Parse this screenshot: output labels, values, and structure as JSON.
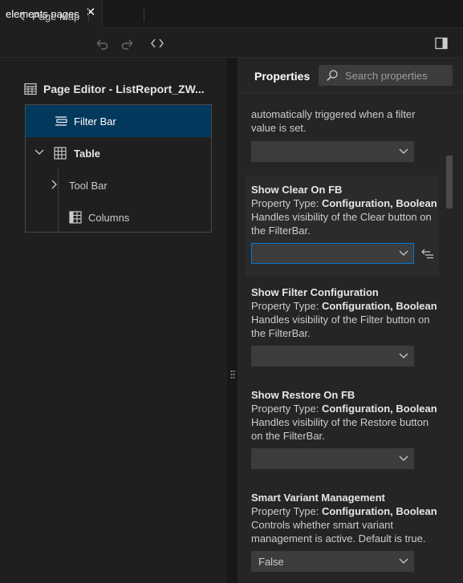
{
  "tab": {
    "title": "elements pages",
    "close_icon": "close-icon"
  },
  "toolbar": {
    "page_map_label": "Page Map",
    "icons": [
      "chevron-left-icon",
      "undo-icon",
      "redo-icon",
      "code-icon",
      "split-editor-icon"
    ]
  },
  "editor": {
    "title": "Page Editor - ListReport_ZW...",
    "tree": [
      {
        "label": "Filter Bar",
        "icon": "filter-bar-icon",
        "selected": true
      },
      {
        "label": "Table",
        "icon": "table-icon",
        "expanded": true
      },
      {
        "label": "Tool Bar",
        "icon": "chevron-right-icon"
      },
      {
        "label": "Columns",
        "icon": "columns-icon"
      }
    ]
  },
  "properties": {
    "title": "Properties",
    "search_placeholder": "Search properties",
    "partial_text_1": "automatically triggered when a filter",
    "partial_text_2": "value is set.",
    "type_prefix": "Property Type:",
    "sections": [
      {
        "title": "Show Clear On FB",
        "type": "Configuration, Boolean",
        "desc1": "Handles visibility of the Clear button on",
        "desc2": "the FilterBar.",
        "value": ""
      },
      {
        "title": "Show Filter Configuration",
        "type": "Configuration, Boolean",
        "desc1": "Handles visibility of the Filter button on",
        "desc2": "the FilterBar.",
        "value": ""
      },
      {
        "title": "Show Restore On FB",
        "type": "Configuration, Boolean",
        "desc1": "Handles visibility of the Restore button",
        "desc2": "on the FilterBar.",
        "value": ""
      },
      {
        "title": "Smart Variant Management",
        "type": "Configuration, Boolean",
        "desc1": "Controls whether smart variant",
        "desc2": "management is active. Default is true.",
        "value": "False"
      }
    ]
  },
  "colors": {
    "accent": "#0078d4",
    "selection": "#04395e",
    "background": "#1f1f1f",
    "panel": "#252526"
  }
}
